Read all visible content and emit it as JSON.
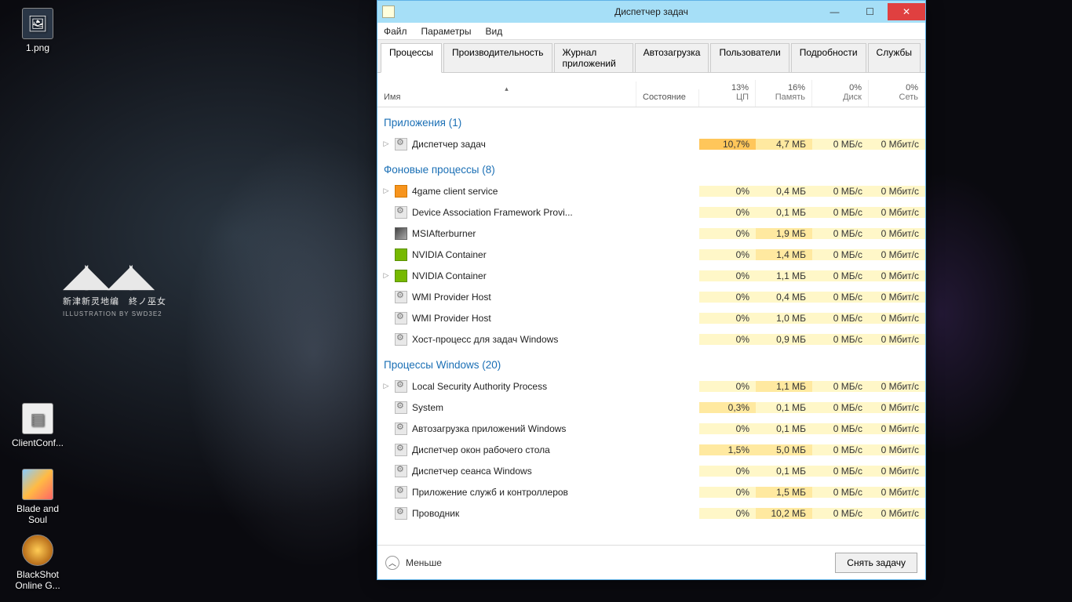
{
  "desktop": {
    "icons": [
      {
        "label": "1.png"
      },
      {
        "label": "ClientConf..."
      },
      {
        "label": "Blade and Soul"
      },
      {
        "label": "BlackShot Online G..."
      }
    ]
  },
  "window": {
    "title": "Диспетчер задач",
    "menu": [
      "Файл",
      "Параметры",
      "Вид"
    ],
    "tabs": [
      "Процессы",
      "Производительность",
      "Журнал приложений",
      "Автозагрузка",
      "Пользователи",
      "Подробности",
      "Службы"
    ],
    "active_tab": 0,
    "columns": {
      "name": "Имя",
      "status": "Состояние",
      "metrics": [
        {
          "pct": "13%",
          "label": "ЦП"
        },
        {
          "pct": "16%",
          "label": "Память"
        },
        {
          "pct": "0%",
          "label": "Диск"
        },
        {
          "pct": "0%",
          "label": "Сеть"
        }
      ]
    },
    "groups": [
      {
        "title": "Приложения (1)",
        "rows": [
          {
            "expand": true,
            "icon": "gear",
            "name": "Диспетчер задач",
            "cpu": "10,7%",
            "mem": "4,7 МБ",
            "disk": "0 МБ/с",
            "net": "0 Мбит/с",
            "heat": [
              4,
              2,
              1,
              1
            ]
          }
        ]
      },
      {
        "title": "Фоновые процессы (8)",
        "rows": [
          {
            "expand": true,
            "icon": "orange",
            "name": "4game client service",
            "cpu": "0%",
            "mem": "0,4 МБ",
            "disk": "0 МБ/с",
            "net": "0 Мбит/с",
            "heat": [
              1,
              1,
              1,
              1
            ]
          },
          {
            "expand": false,
            "icon": "gear",
            "name": "Device Association Framework Provi...",
            "cpu": "0%",
            "mem": "0,1 МБ",
            "disk": "0 МБ/с",
            "net": "0 Мбит/с",
            "heat": [
              1,
              1,
              1,
              1
            ]
          },
          {
            "expand": false,
            "icon": "msi",
            "name": "MSIAfterburner",
            "cpu": "0%",
            "mem": "1,9 МБ",
            "disk": "0 МБ/с",
            "net": "0 Мбит/с",
            "heat": [
              1,
              2,
              1,
              1
            ]
          },
          {
            "expand": false,
            "icon": "green",
            "name": "NVIDIA Container",
            "cpu": "0%",
            "mem": "1,4 МБ",
            "disk": "0 МБ/с",
            "net": "0 Мбит/с",
            "heat": [
              1,
              2,
              1,
              1
            ]
          },
          {
            "expand": true,
            "icon": "green",
            "name": "NVIDIA Container",
            "cpu": "0%",
            "mem": "1,1 МБ",
            "disk": "0 МБ/с",
            "net": "0 Мбит/с",
            "heat": [
              1,
              1,
              1,
              1
            ]
          },
          {
            "expand": false,
            "icon": "gear",
            "name": "WMI Provider Host",
            "cpu": "0%",
            "mem": "0,4 МБ",
            "disk": "0 МБ/с",
            "net": "0 Мбит/с",
            "heat": [
              1,
              1,
              1,
              1
            ]
          },
          {
            "expand": false,
            "icon": "gear",
            "name": "WMI Provider Host",
            "cpu": "0%",
            "mem": "1,0 МБ",
            "disk": "0 МБ/с",
            "net": "0 Мбит/с",
            "heat": [
              1,
              1,
              1,
              1
            ]
          },
          {
            "expand": false,
            "icon": "gear",
            "name": "Хост-процесс для задач Windows",
            "cpu": "0%",
            "mem": "0,9 МБ",
            "disk": "0 МБ/с",
            "net": "0 Мбит/с",
            "heat": [
              1,
              1,
              1,
              1
            ]
          }
        ]
      },
      {
        "title": "Процессы Windows (20)",
        "rows": [
          {
            "expand": true,
            "icon": "gear",
            "name": "Local Security Authority Process",
            "cpu": "0%",
            "mem": "1,1 МБ",
            "disk": "0 МБ/с",
            "net": "0 Мбит/с",
            "heat": [
              1,
              2,
              1,
              1
            ]
          },
          {
            "expand": false,
            "icon": "gear",
            "name": "System",
            "cpu": "0,3%",
            "mem": "0,1 МБ",
            "disk": "0 МБ/с",
            "net": "0 Мбит/с",
            "heat": [
              2,
              1,
              1,
              1
            ]
          },
          {
            "expand": false,
            "icon": "gear",
            "name": "Автозагрузка приложений Windows",
            "cpu": "0%",
            "mem": "0,1 МБ",
            "disk": "0 МБ/с",
            "net": "0 Мбит/с",
            "heat": [
              1,
              1,
              1,
              1
            ]
          },
          {
            "expand": false,
            "icon": "gear",
            "name": "Диспетчер окон рабочего стола",
            "cpu": "1,5%",
            "mem": "5,0 МБ",
            "disk": "0 МБ/с",
            "net": "0 Мбит/с",
            "heat": [
              2,
              2,
              1,
              1
            ]
          },
          {
            "expand": false,
            "icon": "gear",
            "name": "Диспетчер сеанса  Windows",
            "cpu": "0%",
            "mem": "0,1 МБ",
            "disk": "0 МБ/с",
            "net": "0 Мбит/с",
            "heat": [
              1,
              1,
              1,
              1
            ]
          },
          {
            "expand": false,
            "icon": "gear",
            "name": "Приложение служб и контроллеров",
            "cpu": "0%",
            "mem": "1,5 МБ",
            "disk": "0 МБ/с",
            "net": "0 Мбит/с",
            "heat": [
              1,
              2,
              1,
              1
            ]
          },
          {
            "expand": false,
            "icon": "gear",
            "name": "Проводник",
            "cpu": "0%",
            "mem": "10,2 МБ",
            "disk": "0 МБ/с",
            "net": "0 Мбит/с",
            "heat": [
              1,
              2,
              1,
              1
            ]
          }
        ]
      }
    ],
    "footer": {
      "less": "Меньше",
      "end_task": "Снять задачу"
    }
  }
}
